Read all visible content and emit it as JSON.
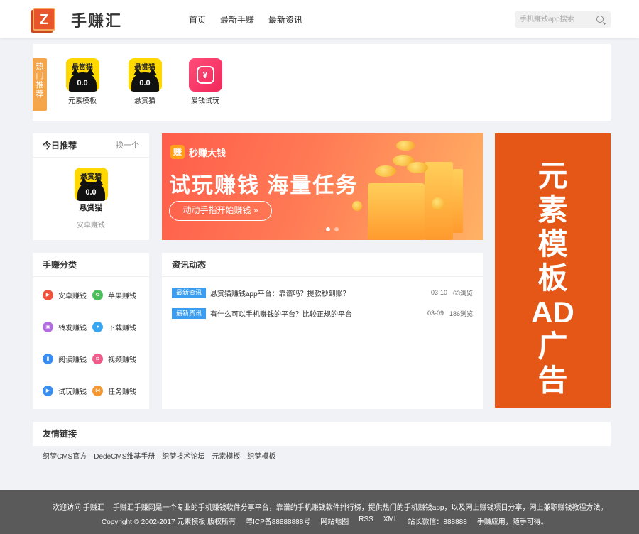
{
  "header": {
    "logo_letter": "Z",
    "site_name": "手赚汇",
    "nav": [
      "首页",
      "最新手赚",
      "最新资讯"
    ],
    "search_placeholder": "手机赚钱app搜索"
  },
  "hot": {
    "tag": "热门推荐",
    "items": [
      {
        "label": "元素模板",
        "icon": "cat-app-icon",
        "icon_title": "悬赏猫",
        "icon_eyes": "0.0"
      },
      {
        "label": "悬赏猫",
        "icon": "cat-app-icon",
        "icon_title": "悬赏猫",
        "icon_eyes": "0.0"
      },
      {
        "label": "爱钱试玩",
        "icon": "yuan-coin-icon",
        "icon_symbol": "¥"
      }
    ]
  },
  "today": {
    "title": "今日推荐",
    "more": "换一个",
    "app_icon_title": "悬赏猫",
    "app_icon_eyes": "0.0",
    "app_name": "悬赏猫",
    "app_sub": "安卓赚钱"
  },
  "banner": {
    "brand_logo": "赚",
    "brand": "秒赚大钱",
    "headline": "试玩赚钱 海量任务",
    "cta": "动动手指开始赚钱 »",
    "active_slide": 1,
    "slides": 2
  },
  "ad": {
    "text": [
      "元",
      "素",
      "模",
      "板",
      "AD",
      "广",
      "告"
    ]
  },
  "categories": {
    "title": "手赚分类",
    "items": [
      {
        "label": "安卓赚钱",
        "color": "#f0523b",
        "glyph": "▶"
      },
      {
        "label": "苹果赚钱",
        "color": "#4cbf5b",
        "glyph": "✿"
      },
      {
        "label": "转发赚钱",
        "color": "#b36be0",
        "glyph": "▣"
      },
      {
        "label": "下载赚钱",
        "color": "#3aa6f0",
        "glyph": "●"
      },
      {
        "label": "阅读赚钱",
        "color": "#3a8df0",
        "glyph": "▮"
      },
      {
        "label": "视频赚钱",
        "color": "#f05b8a",
        "glyph": "◘"
      },
      {
        "label": "试玩赚钱",
        "color": "#3a8df0",
        "glyph": "▶"
      },
      {
        "label": "任务赚钱",
        "color": "#f5972f",
        "glyph": "⋈"
      }
    ]
  },
  "news": {
    "title": "资讯动态",
    "items": [
      {
        "tag": "最新资讯",
        "title": "悬赏猫赚钱app平台：靠谱吗？提款秒到账？",
        "date": "03-10",
        "views": "63浏览"
      },
      {
        "tag": "最新资讯",
        "title": "有什么可以手机赚钱的平台？比较正规的平台",
        "date": "03-09",
        "views": "186浏览"
      }
    ]
  },
  "links": {
    "title": "友情链接",
    "items": [
      "织梦CMS官方",
      "DedeCMS维基手册",
      "织梦技术论坛",
      "元素模板",
      "织梦模板"
    ]
  },
  "footer": {
    "welcome": "欢迎访问 手赚汇",
    "desc": "手赚汇手赚网是一个专业的手机赚钱软件分享平台，靠谱的手机赚钱软件排行榜，提供热门的手机赚钱app，以及网上赚钱项目分享，网上兼职赚钱教程方法。",
    "copyright": "Copyright © 2002-2017 元素模板 版权所有",
    "icp": "粤ICP备88888888号",
    "sitemap": "网站地图",
    "rss": "RSS",
    "xml": "XML",
    "wechat": "站长微信：888888",
    "slogan": "手赚应用，随手可得。"
  }
}
